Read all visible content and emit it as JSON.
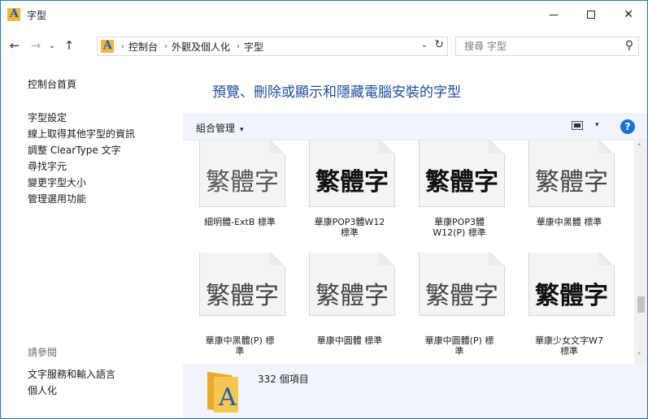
{
  "window": {
    "title": "字型"
  },
  "window_controls": {
    "minimize": "—",
    "maximize": "☐",
    "close": "✕"
  },
  "nav": {
    "back": "←",
    "forward": "→",
    "recent": "⌄",
    "up": "↑"
  },
  "address": {
    "crumbs": [
      "控制台",
      "外觀及個人化",
      "字型"
    ],
    "separator": "›",
    "dropdown": "⌄",
    "refresh": "↻"
  },
  "search": {
    "placeholder": "搜尋 字型",
    "icon": "search-icon"
  },
  "sidebar": {
    "home": "控制台首頁",
    "links": [
      "字型設定",
      "線上取得其他字型的資訊",
      "調整 ClearType 文字",
      "尋找字元",
      "變更字型大小",
      "管理選用功能"
    ],
    "see_also_title": "請參閱",
    "see_also_links": [
      "文字服務和輸入語言",
      "個人化"
    ]
  },
  "main": {
    "heading": "預覽、刪除或顯示和隱藏電腦安裝的字型",
    "organize": "組合管理",
    "organize_caret": "▾",
    "view_caret": "▾",
    "help": "?"
  },
  "fonts": [
    {
      "sample": "繁體字",
      "label_line1": "細明體-ExtB 標準",
      "label_line2": ""
    },
    {
      "sample": "繁體字",
      "label_line1": "華康POP3體W12",
      "label_line2": "標準"
    },
    {
      "sample": "繁體字",
      "label_line1": "華康POP3體",
      "label_line2": "W12(P) 標準"
    },
    {
      "sample": "繁體字",
      "label_line1": "華康中黑體 標準",
      "label_line2": ""
    },
    {
      "sample": "繁體字",
      "label_line1": "華康中黑體(P) 標",
      "label_line2": "準"
    },
    {
      "sample": "繁體字",
      "label_line1": "華康中圓體 標準",
      "label_line2": ""
    },
    {
      "sample": "繁體字",
      "label_line1": "華康中圓體(P) 標",
      "label_line2": "準"
    },
    {
      "sample": "繁體字",
      "label_line1": "華康少女文字W7",
      "label_line2": "標準"
    }
  ],
  "scroll": {
    "up": "˄",
    "down": "˅"
  },
  "details": {
    "count": "332 個項目",
    "icon_letter": "A"
  },
  "app_icon_letter": "A"
}
